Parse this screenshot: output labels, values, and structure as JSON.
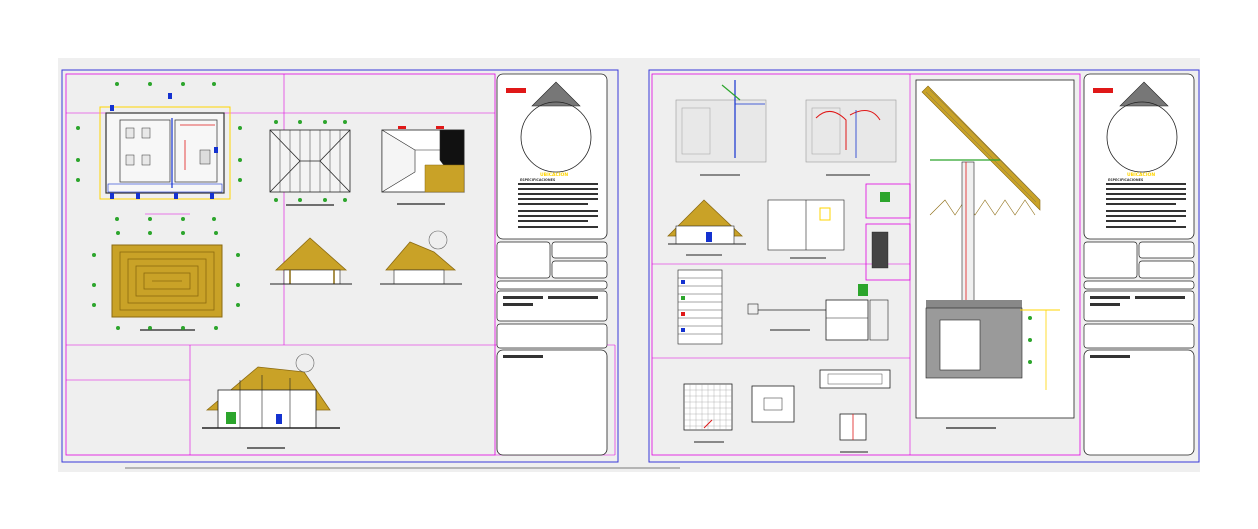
{
  "drawing": {
    "colors": {
      "background": "#efefef",
      "sheet_border": "#3a3ad8",
      "viewport": "#e000e0",
      "line_dark": "#222222",
      "wall": "#555555",
      "thatch": "#c9a227",
      "thatch_dark": "#8b6a10",
      "green_marker": "#2ca52c",
      "blue_marker": "#1432d0",
      "red_marker": "#e01818",
      "yellow": "#ffd400"
    },
    "sheets": [
      {
        "title_block": {
          "location_title": "UBICACION",
          "notes_heading": "ESPECIFICACIONES"
        },
        "views": [
          "floor-plan",
          "roof-framing-plan",
          "roof-plan",
          "thatch-layout-plan",
          "front-elevation",
          "side-elevation",
          "section"
        ]
      },
      {
        "title_block": {
          "location_title": "UBICACION",
          "notes_heading": "ESPECIFICACIONES"
        },
        "views": [
          "water-installation-plan",
          "drainage-installation-plan",
          "section-detail",
          "bathroom-detail",
          "legend",
          "septic-tank-section",
          "eave-detail",
          "slab-plan",
          "box-detail"
        ]
      }
    ]
  }
}
